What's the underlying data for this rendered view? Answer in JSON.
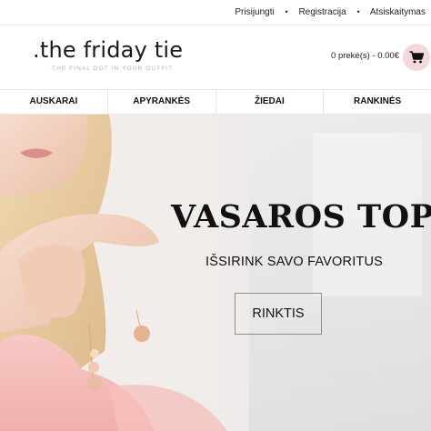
{
  "topbar": {
    "links": [
      "Prisijungti",
      "Registracija",
      "Atsiskaitymas"
    ],
    "separator": "•"
  },
  "header": {
    "logo_name": ".the friday tie",
    "logo_tagline": "THE FINAL DOT IN YOUR OUTFIT",
    "cart_text": "0 prekė(s) - 0.00€",
    "cart_icon": "cart-icon"
  },
  "nav": {
    "items": [
      "AUSKARAI",
      "APYRANKĖS",
      "ŽIEDAI",
      "RANKINĖS"
    ]
  },
  "hero": {
    "title": "VASAROS TOP",
    "subtitle": "IŠSIRINK SAVO FAVORITUS",
    "button_label": "RINKTIS"
  },
  "colors": {
    "cart_circle": "#f2d9da",
    "accent_pink": "#f4b9b7",
    "text": "#111111"
  }
}
